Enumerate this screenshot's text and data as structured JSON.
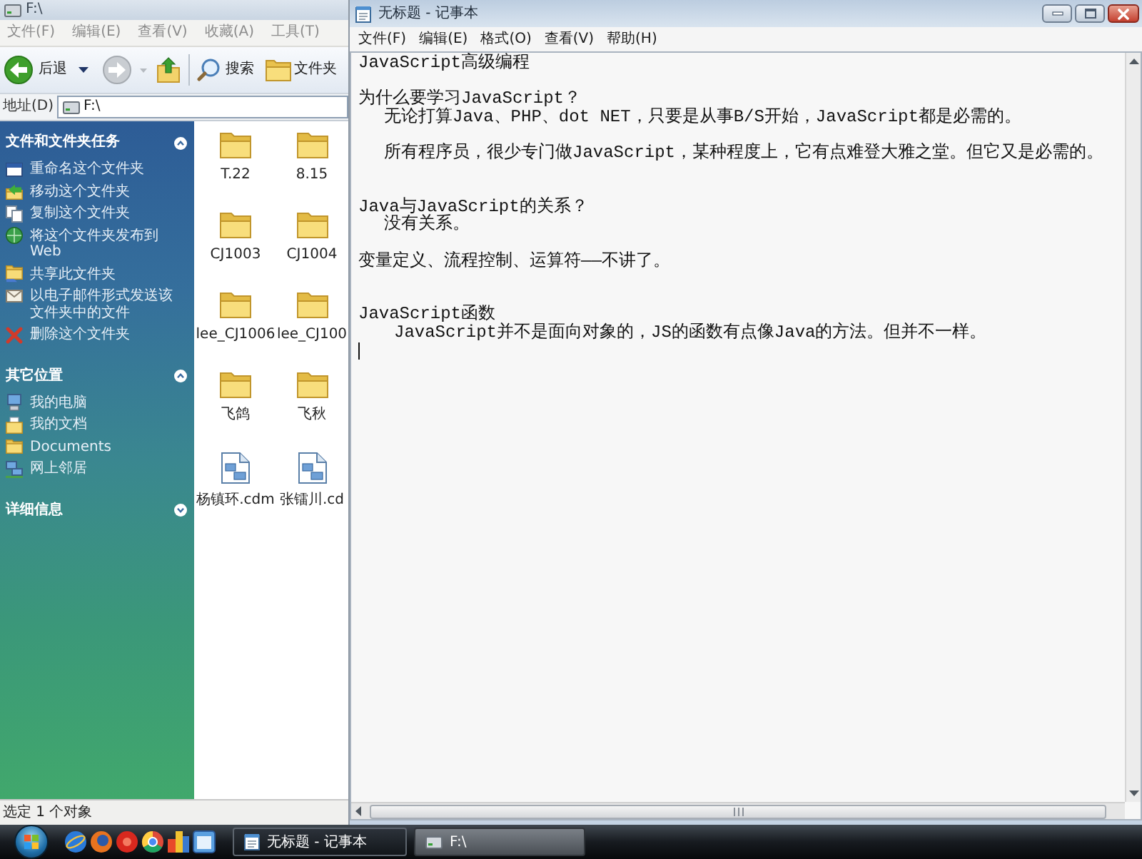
{
  "explorer": {
    "title": "F:\\",
    "menu": [
      "文件(F)",
      "编辑(E)",
      "查看(V)",
      "收藏(A)",
      "工具(T)"
    ],
    "toolbar": [
      {
        "kind": "back",
        "label": "后退",
        "disabled": false
      },
      {
        "kind": "forward",
        "disabled": true
      },
      {
        "kind": "up"
      },
      {
        "kind": "search",
        "label": "搜索"
      },
      {
        "kind": "folders",
        "label": "文件夹"
      }
    ],
    "address": {
      "label": "地址(D)",
      "value": "F:\\"
    },
    "task_pane": [
      {
        "title": "文件和文件夹任务",
        "expanded": true,
        "items": [
          {
            "kind": "rename",
            "label": "重命名这个文件夹"
          },
          {
            "kind": "move",
            "label": "移动这个文件夹"
          },
          {
            "kind": "copy",
            "label": "复制这个文件夹"
          },
          {
            "kind": "publish",
            "label": "将这个文件夹发布到 Web"
          },
          {
            "kind": "share",
            "label": "共享此文件夹"
          },
          {
            "kind": "email",
            "label": "以电子邮件形式发送该文件夹中的文件"
          },
          {
            "kind": "delete",
            "label": "删除这个文件夹"
          }
        ]
      },
      {
        "title": "其它位置",
        "expanded": true,
        "items": [
          {
            "kind": "computer",
            "label": "我的电脑"
          },
          {
            "kind": "documents",
            "label": "我的文档"
          },
          {
            "kind": "folder",
            "label": "Documents"
          },
          {
            "kind": "network",
            "label": "网上邻居"
          }
        ]
      },
      {
        "title": "详细信息",
        "expanded": false
      }
    ],
    "files": [
      {
        "kind": "folder",
        "name": "T.22"
      },
      {
        "kind": "folder",
        "name": "8.15"
      },
      {
        "kind": "folder",
        "name": "CJ1003"
      },
      {
        "kind": "folder",
        "name": "CJ1004"
      },
      {
        "kind": "folder",
        "name": "lee_CJ1006"
      },
      {
        "kind": "folder",
        "name": "lee_CJ100"
      },
      {
        "kind": "folder",
        "name": "飞鸽"
      },
      {
        "kind": "folder",
        "name": "飞秋"
      },
      {
        "kind": "document",
        "name": "杨镇环.cdm"
      },
      {
        "kind": "document",
        "name": "张镭川.cd"
      }
    ],
    "status_bar": "选定 1 个对象"
  },
  "notepad": {
    "title": "无标题 - 记事本",
    "menu": [
      "文件(F)",
      "编辑(E)",
      "格式(O)",
      "查看(V)",
      "帮助(H)"
    ],
    "lines": [
      {
        "kind": "plain",
        "text": "JavaScript高级编程"
      },
      {
        "kind": "blank"
      },
      {
        "kind": "plain",
        "text": "为什么要学习JavaScript？"
      },
      {
        "kind": "indented",
        "text": "无论打算Java、PHP、dot NET，只要是从事B/S开始，JavaScript都是必需的。"
      },
      {
        "kind": "blank"
      },
      {
        "kind": "indented",
        "text": "所有程序员，很少专门做JavaScript，某种程度上，它有点难登大雅之堂。但它又是必需的。"
      },
      {
        "kind": "blank"
      },
      {
        "kind": "blank"
      },
      {
        "kind": "plain",
        "text": "Java与JavaScript的关系？"
      },
      {
        "kind": "indented",
        "text": "没有关系。"
      },
      {
        "kind": "blank"
      },
      {
        "kind": "plain",
        "text": "变量定义、流程控制、运算符——不讲了。"
      },
      {
        "kind": "blank"
      },
      {
        "kind": "blank"
      },
      {
        "kind": "plain",
        "text": "JavaScript函数"
      },
      {
        "kind": "deep-indented",
        "text": "JavaScript并不是面向对象的，JS的函数有点像Java的方法。但并不一样。"
      },
      {
        "kind": "cursor"
      }
    ]
  },
  "taskbar": {
    "tasks": [
      {
        "kind": "notepad",
        "label": "无标题 - 记事本",
        "selected": true
      },
      {
        "kind": "drive",
        "label": "F:\\",
        "selected": false
      }
    ]
  }
}
